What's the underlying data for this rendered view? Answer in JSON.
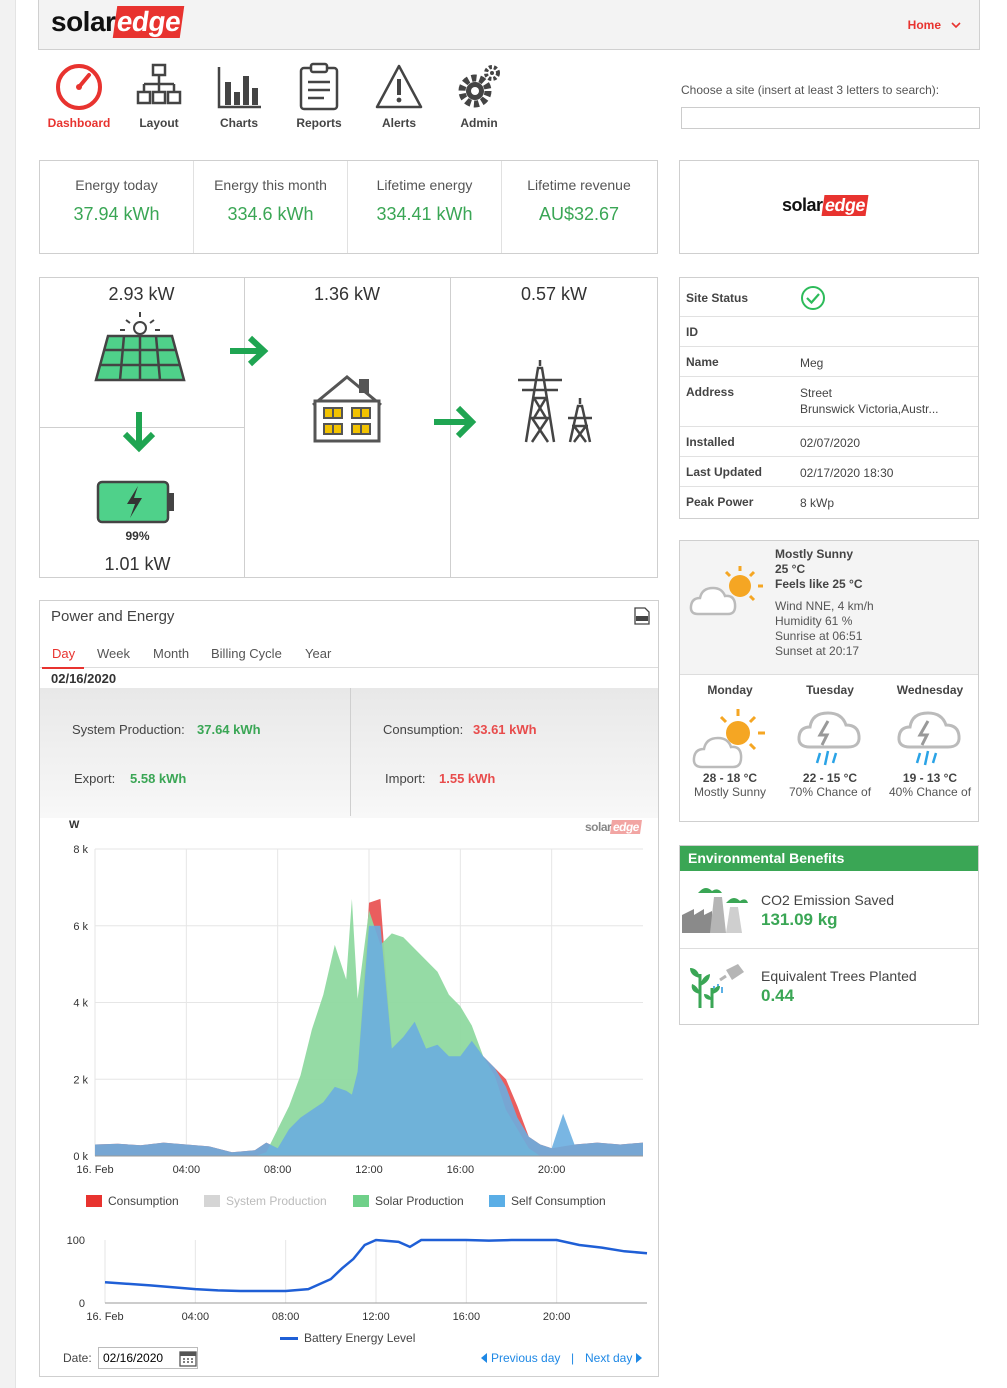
{
  "header": {
    "logo_solar": "solar",
    "logo_edge": "edge",
    "home_label": "Home"
  },
  "nav": [
    {
      "label": "Dashboard",
      "icon": "speedometer-icon",
      "active": true
    },
    {
      "label": "Layout",
      "icon": "layout-tree-icon"
    },
    {
      "label": "Charts",
      "icon": "bar-chart-icon"
    },
    {
      "label": "Reports",
      "icon": "clipboard-icon"
    },
    {
      "label": "Alerts",
      "icon": "warning-icon"
    },
    {
      "label": "Admin",
      "icon": "gear-icon"
    }
  ],
  "site_search": {
    "label": "Choose a site (insert at least 3 letters to search):",
    "value": ""
  },
  "stats": [
    {
      "label": "Energy today",
      "value": "37.94 kWh"
    },
    {
      "label": "Energy this month",
      "value": "334.6 kWh"
    },
    {
      "label": "Lifetime energy",
      "value": "334.41 kWh"
    },
    {
      "label": "Lifetime revenue",
      "value": "AU$32.67"
    }
  ],
  "flow": {
    "solar_power": "2.93 kW",
    "home_power": "1.36 kW",
    "grid_power": "0.57 kW",
    "battery_percent": "99%",
    "battery_power": "1.01 kW"
  },
  "site_status": {
    "rows": [
      {
        "key": "Site Status",
        "value": ""
      },
      {
        "key": "ID",
        "value": ""
      },
      {
        "key": "Name",
        "value": "Meg"
      },
      {
        "key": "Address",
        "value": "Street",
        "value2": "Brunswick Victoria,Austr..."
      },
      {
        "key": "Installed",
        "value": "02/07/2020"
      },
      {
        "key": "Last Updated",
        "value": "02/17/2020 18:30"
      },
      {
        "key": "Peak Power",
        "value": "8 kWp"
      }
    ]
  },
  "weather": {
    "current": {
      "condition": "Mostly Sunny",
      "temp": "25 °C",
      "feels": "Feels like 25 °C",
      "wind": "Wind NNE, 4 km/h",
      "humidity": "Humidity 61 %",
      "sunrise": "Sunrise at 06:51",
      "sunset": "Sunset at 20:17"
    },
    "forecast": [
      {
        "day": "Monday",
        "temp": "28 - 18 °C",
        "desc": "Mostly Sunny",
        "icon": "partly-sunny-icon"
      },
      {
        "day": "Tuesday",
        "temp": "22 - 15 °C",
        "desc": "70% Chance of",
        "icon": "storm-icon"
      },
      {
        "day": "Wednesday",
        "temp": "19 - 13 °C",
        "desc": "40% Chance of",
        "icon": "storm-icon"
      }
    ]
  },
  "env": {
    "title": "Environmental Benefits",
    "co2_label": "CO2 Emission Saved",
    "co2_value": "131.09 kg",
    "trees_label": "Equivalent Trees Planted",
    "trees_value": "0.44"
  },
  "power_energy": {
    "title": "Power and Energy",
    "tabs": [
      "Day",
      "Week",
      "Month",
      "Billing Cycle",
      "Year"
    ],
    "active_tab": "Day",
    "date_heading": "02/16/2020",
    "system_production_label": "System Production:",
    "system_production_value": "37.64 kWh",
    "consumption_label": "Consumption:",
    "consumption_value": "33.61 kWh",
    "export_label": "Export:",
    "export_value": "5.58 kWh",
    "import_label": "Import:",
    "import_value": "1.55 kWh",
    "date_label": "Date:",
    "date_value": "02/16/2020",
    "prev_day": "Previous day",
    "next_day": "Next day",
    "separator": "|"
  },
  "colors": {
    "accent": "#e8332f",
    "green": "#3aa655",
    "consumption": "#e84c4c",
    "solar": "#8fd9a0",
    "self": "#7ab8e2",
    "battery_line": "#1f5fd6"
  },
  "chart_data": [
    {
      "type": "area",
      "xlabel": "",
      "ylabel": "W",
      "xticks": [
        "16. Feb",
        "04:00",
        "08:00",
        "12:00",
        "16:00",
        "20:00"
      ],
      "yticks": [
        "0 k",
        "2 k",
        "4 k",
        "6 k",
        "8 k"
      ],
      "ylim": [
        0,
        8000
      ],
      "xlim_hours": [
        0,
        24
      ],
      "x_hours": [
        0,
        1,
        2,
        3,
        4,
        5,
        6,
        7,
        7.5,
        8,
        8.5,
        9,
        9.5,
        10,
        10.5,
        11,
        11.25,
        11.5,
        12,
        12.5,
        13,
        13.5,
        14,
        14.5,
        15,
        15.5,
        16,
        16.5,
        17,
        17.5,
        18,
        18.5,
        19,
        19.5,
        20,
        20.5,
        21,
        22,
        23,
        24
      ],
      "series": [
        {
          "name": "Consumption",
          "values": [
            300,
            320,
            280,
            350,
            300,
            250,
            100,
            150,
            350,
            200,
            700,
            1000,
            1200,
            1400,
            1800,
            1700,
            1600,
            2200,
            6600,
            6700,
            2800,
            3100,
            3500,
            2800,
            2900,
            2600,
            2600,
            3000,
            2600,
            2300,
            2000,
            1300,
            500,
            300,
            200,
            250,
            300,
            350,
            300,
            350
          ]
        },
        {
          "name": "System Production",
          "values": []
        },
        {
          "name": "Solar Production",
          "values": [
            0,
            0,
            0,
            0,
            0,
            0,
            0,
            0,
            100,
            700,
            1300,
            2100,
            3300,
            4200,
            5500,
            4600,
            6700,
            4100,
            6400,
            5500,
            5800,
            5700,
            5400,
            5100,
            4800,
            4200,
            3900,
            3400,
            2600,
            2100,
            1200,
            700,
            200,
            0,
            0,
            0,
            0,
            0,
            0,
            0
          ]
        },
        {
          "name": "Self Consumption",
          "values": [
            300,
            320,
            280,
            350,
            300,
            250,
            100,
            150,
            350,
            200,
            700,
            1000,
            1200,
            1400,
            1800,
            1700,
            1600,
            2200,
            6000,
            6000,
            2800,
            3100,
            3500,
            2800,
            2900,
            2600,
            2600,
            3000,
            2600,
            2300,
            1800,
            1000,
            500,
            300,
            200,
            1100,
            300,
            350,
            300,
            350
          ]
        }
      ]
    },
    {
      "type": "line",
      "xticks": [
        "16. Feb",
        "04:00",
        "08:00",
        "12:00",
        "16:00",
        "20:00"
      ],
      "yticks": [
        "0",
        "100"
      ],
      "ylim": [
        0,
        100
      ],
      "series": [
        {
          "name": "Battery Energy Level",
          "x_hours": [
            0,
            2,
            4,
            5,
            6,
            7,
            8,
            9,
            10,
            10.5,
            11,
            11.5,
            12,
            13,
            13.5,
            14,
            15,
            16,
            17,
            18,
            19,
            20,
            21,
            22,
            23,
            24
          ],
          "values": [
            33,
            28,
            22,
            20,
            19,
            19,
            19,
            22,
            38,
            55,
            70,
            92,
            100,
            97,
            89,
            100,
            100,
            100,
            99,
            100,
            100,
            100,
            92,
            88,
            82,
            79
          ]
        }
      ]
    }
  ]
}
